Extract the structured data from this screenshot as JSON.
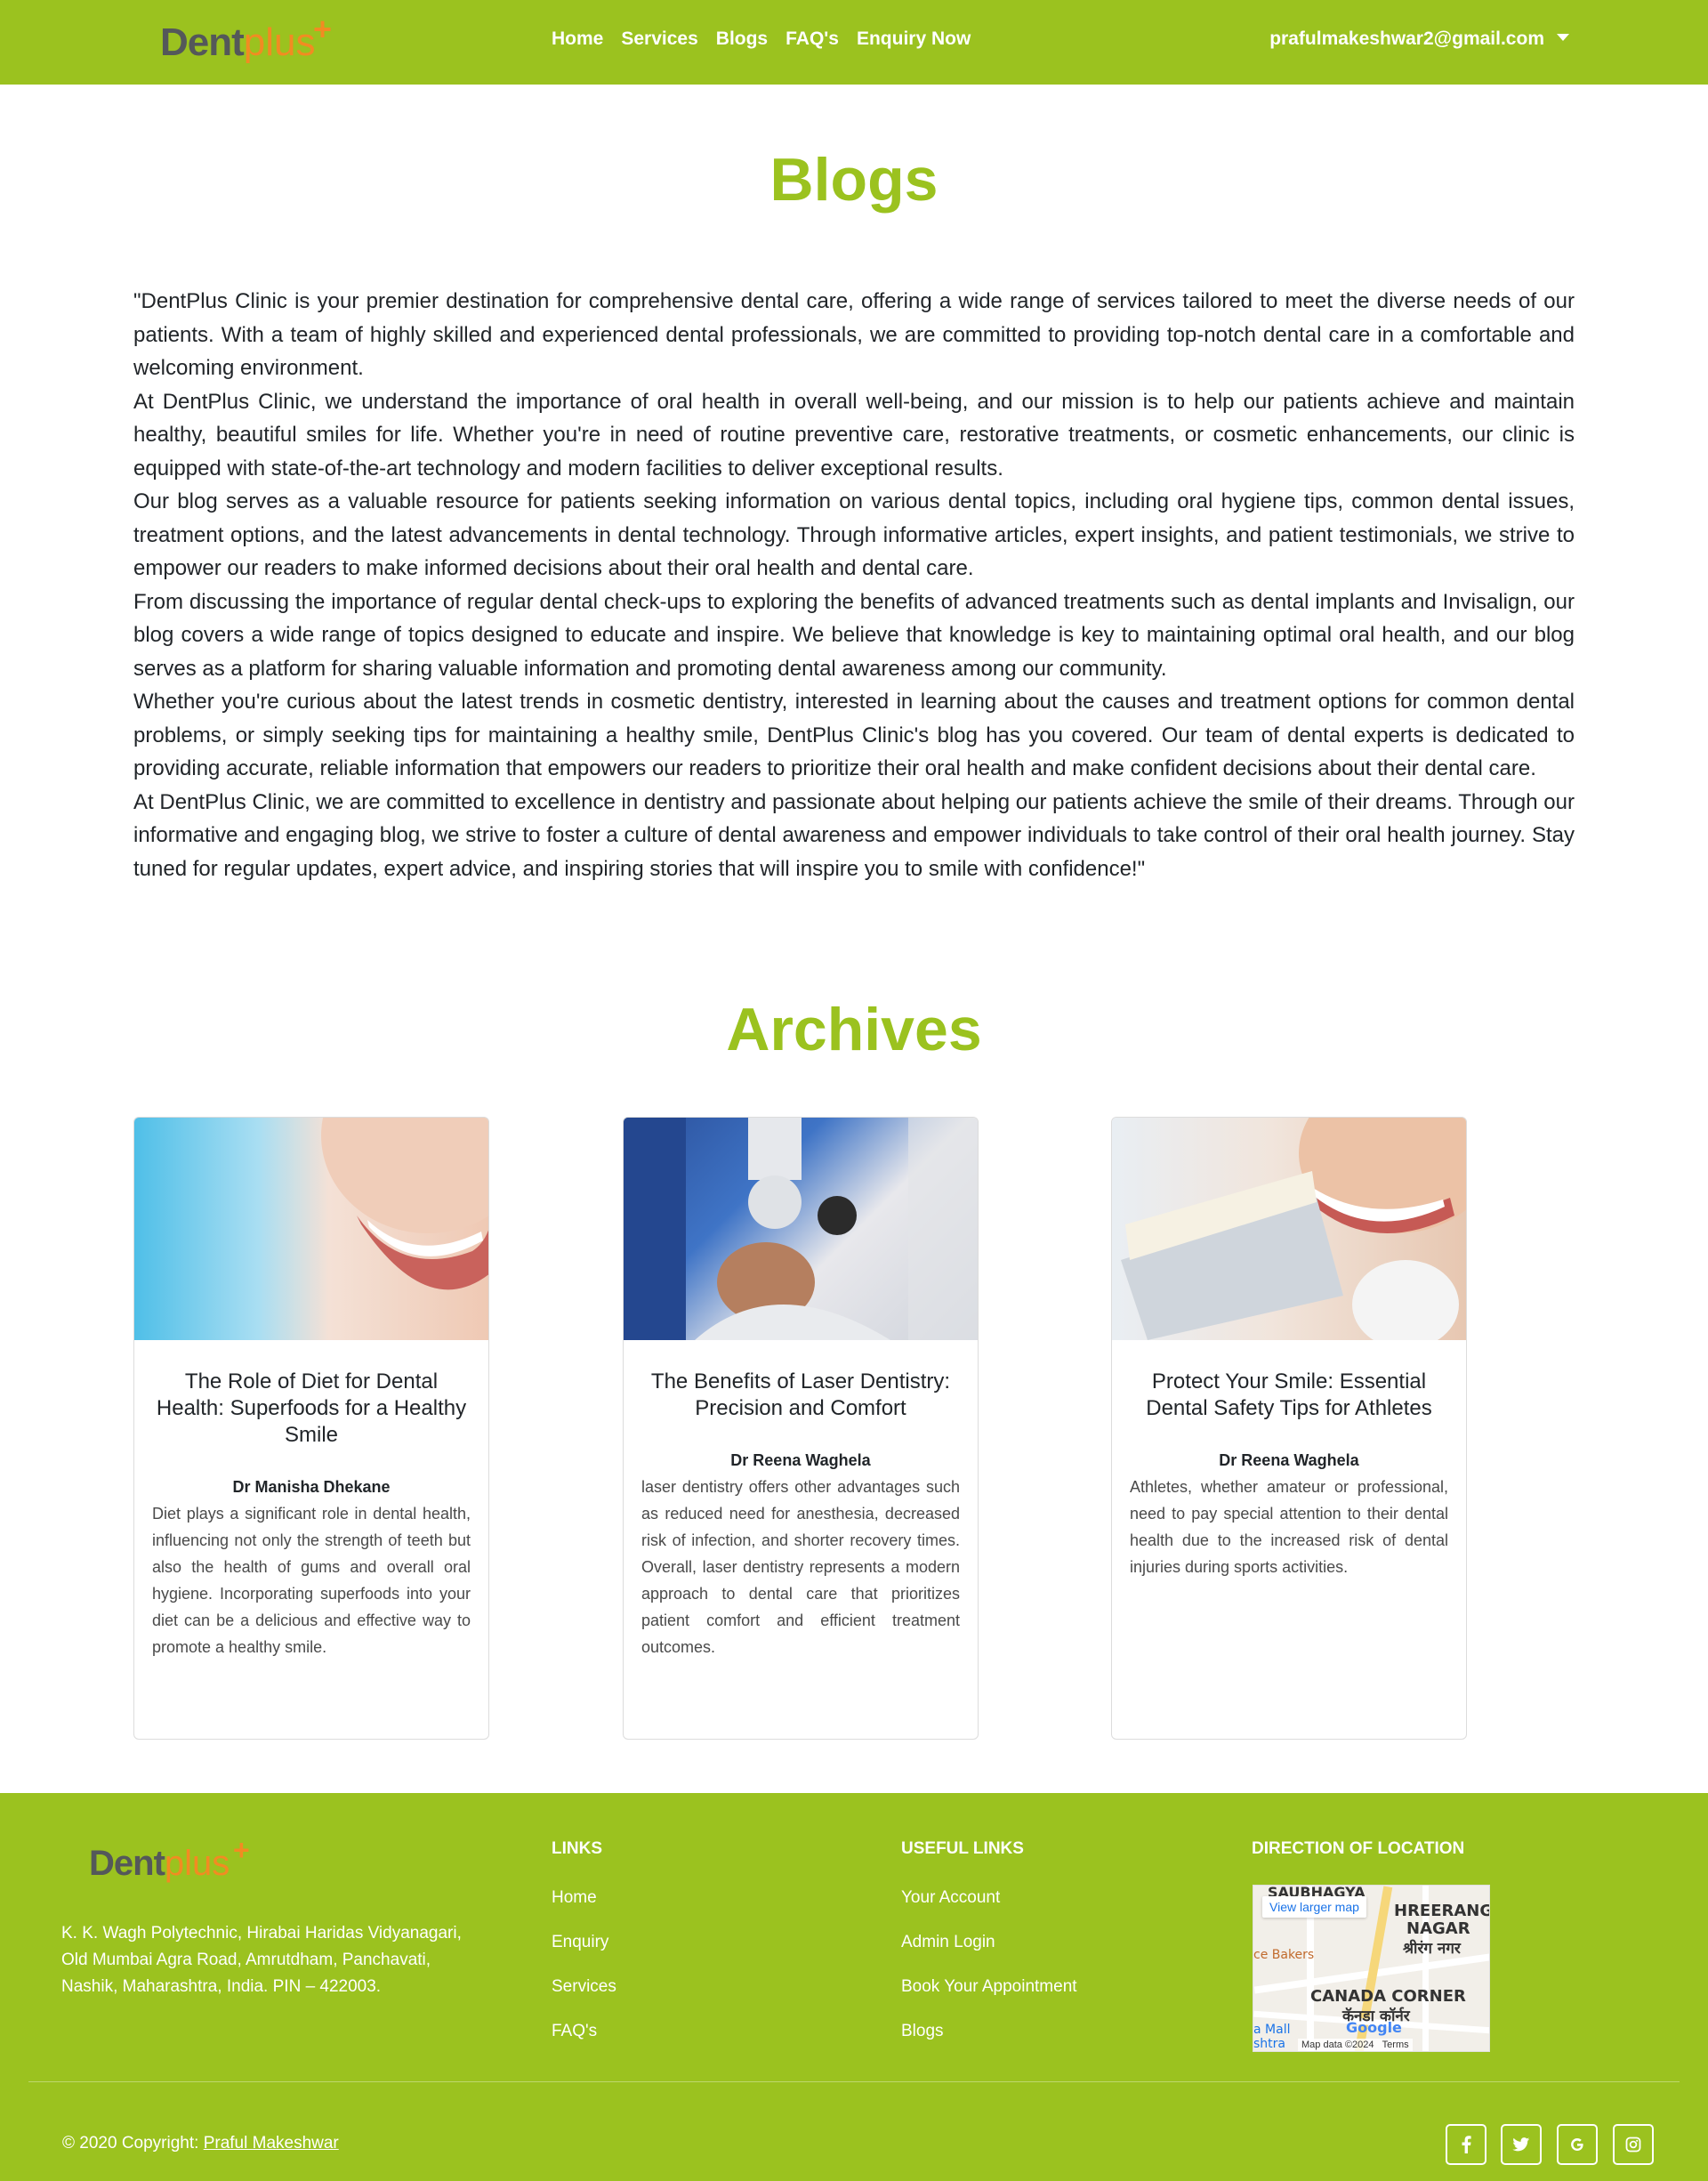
{
  "nav": {
    "logo": {
      "part1": "Dent",
      "part2": "plus",
      "mark": "+"
    },
    "links": [
      "Home",
      "Services",
      "Blogs",
      "FAQ's",
      "Enquiry Now"
    ],
    "user_email": "prafulmakeshwar2@gmail.com"
  },
  "page_title": "Blogs",
  "intro": [
    "\"DentPlus Clinic is your premier destination for comprehensive dental care, offering a wide range of services tailored to meet the diverse needs of our patients. With a team of highly skilled and experienced dental professionals, we are committed to providing top-notch dental care in a comfortable and welcoming environment.",
    "At DentPlus Clinic, we understand the importance of oral health in overall well-being, and our mission is to help our patients achieve and maintain healthy, beautiful smiles for life. Whether you're in need of routine preventive care, restorative treatments, or cosmetic enhancements, our clinic is equipped with state-of-the-art technology and modern facilities to deliver exceptional results.",
    "Our blog serves as a valuable resource for patients seeking information on various dental topics, including oral hygiene tips, common dental issues, treatment options, and the latest advancements in dental technology. Through informative articles, expert insights, and patient testimonials, we strive to empower our readers to make informed decisions about their oral health and dental care.",
    "From discussing the importance of regular dental check-ups to exploring the benefits of advanced treatments such as dental implants and Invisalign, our blog covers a wide range of topics designed to educate and inspire. We believe that knowledge is key to maintaining optimal oral health, and our blog serves as a platform for sharing valuable information and promoting dental awareness among our community.",
    "Whether you're curious about the latest trends in cosmetic dentistry, interested in learning about the causes and treatment options for common dental problems, or simply seeking tips for maintaining a healthy smile, DentPlus Clinic's blog has you covered. Our team of dental experts is dedicated to providing accurate, reliable information that empowers our readers to prioritize their oral health and make confident decisions about their dental care.",
    "At DentPlus Clinic, we are committed to excellence in dentistry and passionate about helping our patients achieve the smile of their dreams. Through our informative and engaging blog, we strive to foster a culture of dental awareness and empower individuals to take control of their oral health journey. Stay tuned for regular updates, expert advice, and inspiring stories that will inspire you to smile with confidence!\""
  ],
  "archives_title": "Archives",
  "cards": [
    {
      "title": "The Role of Diet for Dental Health: Superfoods for a Healthy Smile",
      "author": "Dr Manisha Dhekane",
      "text": "Diet plays a significant role in dental health, influencing not only the strength of teeth but also the health of gums and overall oral hygiene. Incorporating superfoods into your diet can be a delicious and effective way to promote a healthy smile."
    },
    {
      "title": "The Benefits of Laser Dentistry: Precision and Comfort",
      "author": "Dr Reena Waghela",
      "text": "laser dentistry offers other advantages such as reduced need for anesthesia, decreased risk of infection, and shorter recovery times. Overall, laser dentistry represents a modern approach to dental care that prioritizes patient comfort and efficient treatment outcomes."
    },
    {
      "title": "Protect Your Smile: Essential Dental Safety Tips for Athletes",
      "author": "Dr Reena Waghela",
      "text": "Athletes, whether amateur or professional, need to pay special attention to their dental health due to the increased risk of dental injuries during sports activities."
    }
  ],
  "footer": {
    "address": "K. K. Wagh Polytechnic, Hirabai Haridas Vidyanagari, Old Mumbai Agra Road, Amrutdham, Panchavati, Nashik, Maharashtra, India. PIN – 422003.",
    "links_heading": "LINKS",
    "links": [
      "Home",
      "Enquiry",
      "Services",
      "FAQ's"
    ],
    "useful_heading": "USEFUL LINKS",
    "useful_links": [
      "Your Account",
      "Admin Login",
      "Book Your Appointment",
      "Blogs"
    ],
    "map_heading": "DIRECTION OF LOCATION",
    "map": {
      "view_larger": "View larger map",
      "labels": [
        "SAUBHAGYA",
        "HREERANG",
        "NAGAR",
        "श्रीरंग नगर",
        "ce Bakers",
        "CANADA CORNER",
        "कॅनडा कॉर्नर",
        "a Mall",
        "shtra"
      ],
      "attribution": "Map data ©2024",
      "terms": "Terms",
      "google": "Google"
    },
    "copyright_prefix": "© 2020 Copyright: ",
    "copyright_name": "Praful Makeshwar",
    "social_icons": [
      "facebook-icon",
      "twitter-icon",
      "google-icon",
      "instagram-icon"
    ]
  },
  "colors": {
    "brand_green": "#9bc21f",
    "logo_gray": "#54585a",
    "logo_orange": "#f28b22"
  }
}
